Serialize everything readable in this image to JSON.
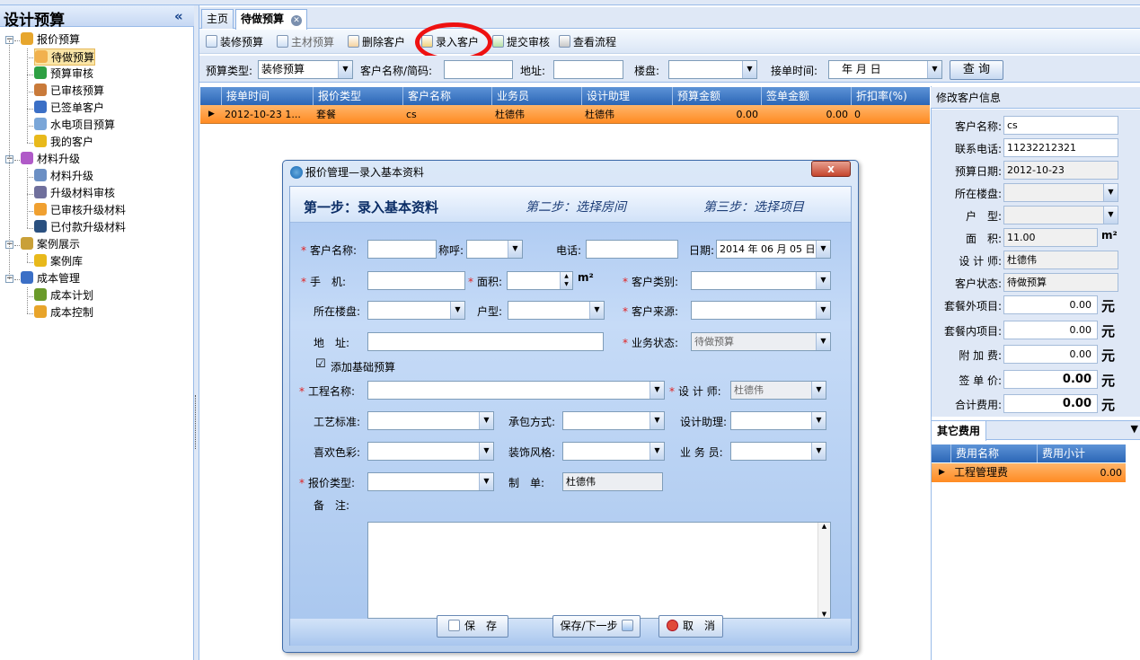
{
  "left_panel": {
    "title": "设计预算",
    "collapse_glyph": "«",
    "tree": [
      {
        "label": "报价预算",
        "level": 0,
        "icon": "quote-icon",
        "color": "#e7a62d",
        "toggle": "−"
      },
      {
        "label": "待做预算",
        "level": 1,
        "icon": "pending-budget-icon",
        "color": "#f1b14e",
        "selected": true
      },
      {
        "label": "预算审核",
        "level": 1,
        "icon": "budget-review-icon",
        "color": "#2ea043"
      },
      {
        "label": "已审核预算",
        "level": 1,
        "icon": "reviewed-budget-icon",
        "color": "#c97a3a"
      },
      {
        "label": "已签单客户",
        "level": 1,
        "icon": "signed-customer-icon",
        "color": "#3b6fc6"
      },
      {
        "label": "水电项目预算",
        "level": 1,
        "icon": "utility-budget-icon",
        "color": "#7aa6d8"
      },
      {
        "label": "我的客户",
        "level": 1,
        "icon": "my-customer-icon",
        "color": "#e8b91b"
      },
      {
        "label": "材料升级",
        "level": 0,
        "icon": "material-upgrade-icon",
        "color": "#b05ac8",
        "toggle": "−"
      },
      {
        "label": "材料升级",
        "level": 1,
        "icon": "material-upgrade-sub-icon",
        "color": "#6b8fc4"
      },
      {
        "label": "升级材料审核",
        "level": 1,
        "icon": "upgrade-review-icon",
        "color": "#6f6f9c"
      },
      {
        "label": "已审核升级材料",
        "level": 1,
        "icon": "reviewed-upgrade-icon",
        "color": "#f0a030"
      },
      {
        "label": "已付款升级材料",
        "level": 1,
        "icon": "paid-upgrade-icon",
        "color": "#2a5080"
      },
      {
        "label": "案例展示",
        "level": 0,
        "icon": "case-display-icon",
        "color": "#c9a038",
        "toggle": "−"
      },
      {
        "label": "案例库",
        "level": 1,
        "icon": "case-library-icon",
        "color": "#e8b91b"
      },
      {
        "label": "成本管理",
        "level": 0,
        "icon": "cost-management-icon",
        "color": "#3b6fc6",
        "toggle": "−"
      },
      {
        "label": "成本计划",
        "level": 1,
        "icon": "cost-plan-icon",
        "color": "#6a9a2a"
      },
      {
        "label": "成本控制",
        "level": 1,
        "icon": "cost-control-icon",
        "color": "#e8a42a"
      }
    ]
  },
  "tabs": {
    "home": "主页",
    "active": "待做预算",
    "close_glyph": "✕"
  },
  "toolbar": {
    "buttons": [
      "装修预算",
      "主材预算",
      "删除客户",
      "录入客户",
      "提交审核",
      "查看流程"
    ]
  },
  "search": {
    "budget_type_label": "预算类型:",
    "budget_type_value": "装修预算",
    "customer_label": "客户名称/简码:",
    "customer_value": "",
    "address_label": "地址:",
    "address_value": "",
    "building_label": "楼盘:",
    "building_value": "",
    "date_label": "接单时间:",
    "date_value": "年  月  日",
    "query_label": "查 询"
  },
  "grid": {
    "columns": [
      "接单时间",
      "报价类型",
      "客户名称",
      "业务员",
      "设计助理",
      "预算金额",
      "签单金额",
      "折扣率(%)"
    ],
    "rows": [
      [
        "2012-10-23 1...",
        "套餐",
        "cs",
        "杜德伟",
        "杜德伟",
        "0.00",
        "0.00",
        "0"
      ]
    ]
  },
  "right_panel": {
    "title": "修改客户信息",
    "fields": [
      {
        "label": "客户名称:",
        "value": "cs"
      },
      {
        "label": "联系电话:",
        "value": "11232212321"
      },
      {
        "label": "预算日期:",
        "value": "2012-10-23"
      },
      {
        "label": "所在楼盘:",
        "value": ""
      },
      {
        "label": "户　型:",
        "value": ""
      },
      {
        "label": "面　积:",
        "value": "11.00"
      },
      {
        "label": "设 计 师:",
        "value": "杜德伟"
      },
      {
        "label": "客户状态:",
        "value": "待做预算"
      }
    ],
    "area_unit": "m²",
    "money": [
      {
        "label": "套餐外项目:",
        "value": "0.00",
        "bold": false
      },
      {
        "label": "套餐内项目:",
        "value": "0.00",
        "bold": false
      },
      {
        "label": "附 加 费:",
        "value": "0.00",
        "bold": false
      },
      {
        "label": "签 单 价:",
        "value": "0.00",
        "bold": true
      },
      {
        "label": "合计费用:",
        "value": "0.00",
        "bold": true
      }
    ],
    "currency_unit": "元",
    "other_fees_tab": "其它费用",
    "other_columns": [
      "费用名称",
      "费用小计"
    ],
    "other_rows": [
      [
        "工程管理费",
        "0.00"
      ]
    ]
  },
  "dialog": {
    "title": "报价管理—录入基本资料",
    "close_glyph": "x",
    "steps": [
      "第一步：录入基本资料",
      "第二步：选择房间",
      "第三步：选择项目"
    ],
    "labels": {
      "customer_name": "客户名称:",
      "salutation": "称呼:",
      "phone": "电话:",
      "date": "日期:",
      "mobile": "手　机:",
      "area": "面积:",
      "area_unit": "m²",
      "customer_type": "客户类别:",
      "building": "所在楼盘:",
      "house_type": "户型:",
      "customer_source": "客户来源:",
      "address": "地　址:",
      "business_status": "业务状态:",
      "add_basic_budget": "添加基础预算",
      "project_name": "工程名称:",
      "designer": "设 计 师:",
      "craft_standard": "工艺标准:",
      "contract_method": "承包方式:",
      "design_assistant": "设计助理:",
      "favorite_color": "喜欢色彩:",
      "decor_style": "装饰风格:",
      "salesperson": "业 务 员:",
      "quote_type": "报价类型:",
      "creator": "制　单:",
      "notes": "备　注:"
    },
    "values": {
      "date": "2014 年 06 月 05 日",
      "business_status": "待做预算",
      "designer": "杜德伟",
      "creator": "杜德伟",
      "add_basic_budget_checked": "☑"
    },
    "buttons": {
      "save": "保　存",
      "save_next": "保存/下一步",
      "cancel": "取　消"
    }
  }
}
